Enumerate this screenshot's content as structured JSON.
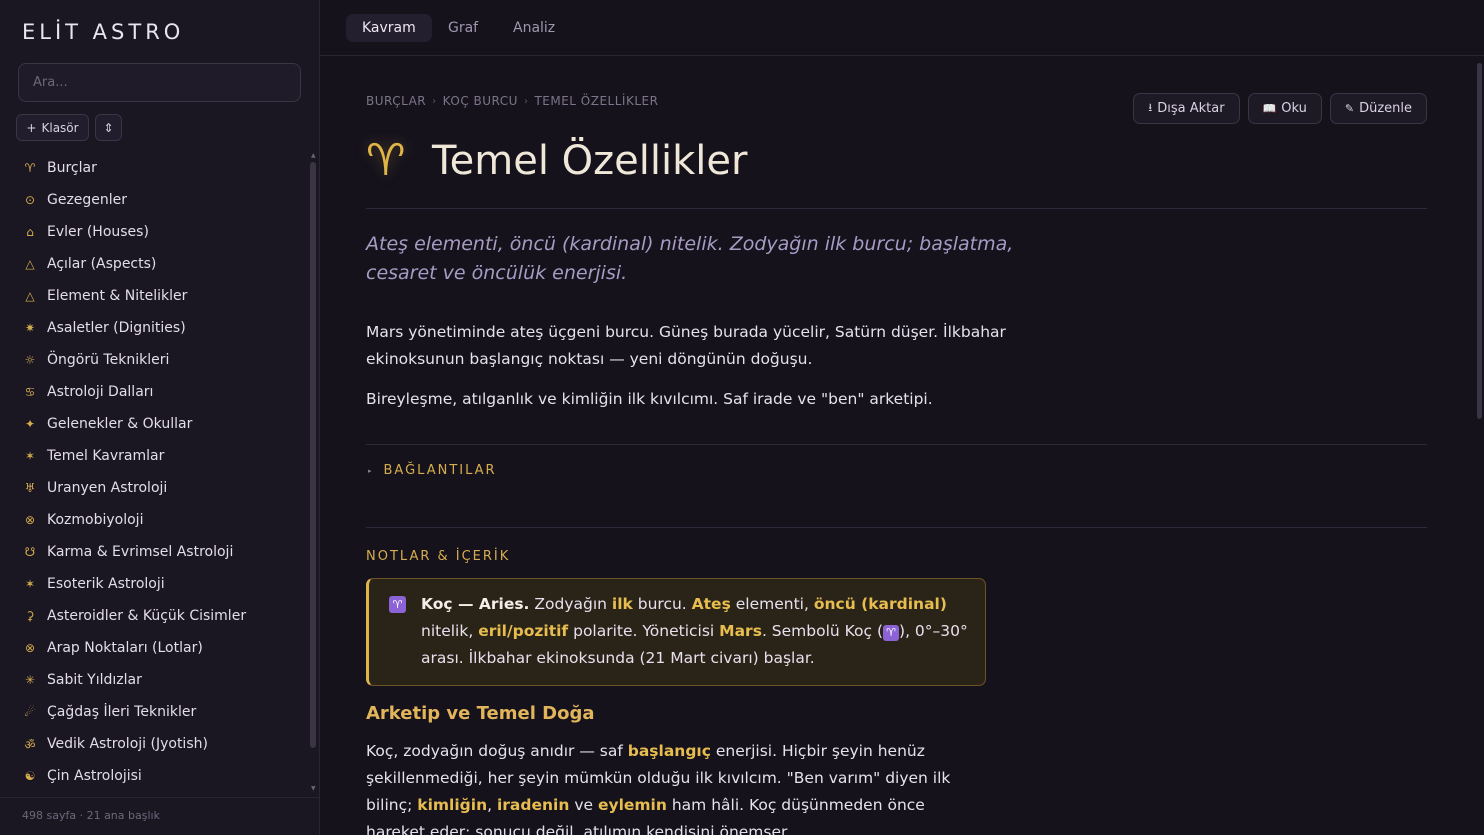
{
  "sidebar": {
    "brand": "ELİT ASTRO",
    "search_placeholder": "Ara...",
    "folder_button": {
      "icon": "+",
      "label": "Klasör"
    },
    "sort_button": "⇕",
    "items": [
      {
        "icon": "♈",
        "label": "Burçlar"
      },
      {
        "icon": "⊙",
        "label": "Gezegenler"
      },
      {
        "icon": "⌂",
        "label": "Evler (Houses)"
      },
      {
        "icon": "△",
        "label": "Açılar (Aspects)"
      },
      {
        "icon": "△",
        "label": "Element & Nitelikler"
      },
      {
        "icon": "✷",
        "label": "Asaletler (Dignities)"
      },
      {
        "icon": "☼",
        "label": "Öngörü Teknikleri"
      },
      {
        "icon": "♋",
        "label": "Astroloji Dalları"
      },
      {
        "icon": "✦",
        "label": "Gelenekler & Okullar"
      },
      {
        "icon": "✶",
        "label": "Temel Kavramlar"
      },
      {
        "icon": "♅",
        "label": "Uranyen Astroloji"
      },
      {
        "icon": "⊗",
        "label": "Kozmobiyoloji"
      },
      {
        "icon": "☋",
        "label": "Karma & Evrimsel Astroloji"
      },
      {
        "icon": "✶",
        "label": "Esoterik Astroloji"
      },
      {
        "icon": "⚳",
        "label": "Asteroidler & Küçük Cisimler"
      },
      {
        "icon": "⊗",
        "label": "Arap Noktaları (Lotlar)"
      },
      {
        "icon": "✳",
        "label": "Sabit Yıldızlar"
      },
      {
        "icon": "☄",
        "label": "Çağdaş İleri Teknikler"
      },
      {
        "icon": "ॐ",
        "label": "Vedik Astroloji (Jyotish)"
      },
      {
        "icon": "☯",
        "label": "Çin Astrolojisi"
      }
    ],
    "footer": "498 sayfa · 21 ana başlık"
  },
  "tabs": [
    {
      "label": "Kavram",
      "active": true
    },
    {
      "label": "Graf",
      "active": false
    },
    {
      "label": "Analiz",
      "active": false
    }
  ],
  "breadcrumb": [
    "BURÇLAR",
    "KOÇ BURCU",
    "TEMEL ÖZELLİKLER"
  ],
  "breadcrumb_sep": "›",
  "actions": [
    {
      "icon": "⭳",
      "label": "Dışa Aktar"
    },
    {
      "icon": "📖",
      "label": "Oku"
    },
    {
      "icon": "✎",
      "label": "Düzenle"
    }
  ],
  "page": {
    "icon": "♈",
    "title": "Temel Özellikler",
    "lead": "Ateş elementi, öncü (kardinal) nitelik. Zodyağın ilk burcu; başlatma, cesaret ve öncülük enerjisi.",
    "paragraphs": [
      "Mars yönetiminde ateş üçgeni burcu. Güneş burada yücelir, Satürn düşer. İlkbahar ekinoksunun başlangıç noktası — yeni döngünün doğuşu.",
      "Bireyleşme, atılganlık ve kimliğin ilk kıvılcımı. Saf irade ve \"ben\" arketipi."
    ],
    "links_label": "BAĞLANTILAR",
    "links_marker": "▸",
    "notes_label": "NOTLAR & İÇERİK",
    "callout": {
      "badge": "♈",
      "segments": [
        {
          "t": "Koç — Aries.",
          "s": "strong"
        },
        {
          "t": " Zodyağın ",
          "s": ""
        },
        {
          "t": "ilk",
          "s": "hl"
        },
        {
          "t": " burcu. ",
          "s": ""
        },
        {
          "t": "Ateş",
          "s": "hl"
        },
        {
          "t": " elementi, ",
          "s": ""
        },
        {
          "t": "öncü (kardinal)",
          "s": "hl"
        },
        {
          "t": " nitelik, ",
          "s": ""
        },
        {
          "t": "eril/pozitif",
          "s": "hl"
        },
        {
          "t": " polarite. Yöneticisi ",
          "s": ""
        },
        {
          "t": "Mars",
          "s": "hl"
        },
        {
          "t": ". Sembolü Koç (",
          "s": ""
        },
        {
          "t": "♈",
          "s": "badge"
        },
        {
          "t": "), 0°–30° arası. İlkbahar ekinoksunda (21 Mart civarı) başlar.",
          "s": ""
        }
      ]
    },
    "section_title": "Arketip ve Temel Doğa",
    "section_segments": [
      {
        "t": "Koç, zodyağın doğuş anıdır — saf ",
        "s": ""
      },
      {
        "t": "başlangıç",
        "s": "hl"
      },
      {
        "t": " enerjisi. Hiçbir şeyin henüz şekillenmediği, her şeyin mümkün olduğu ilk kıvılcım. \"Ben varım\" diyen ilk bilinç; ",
        "s": ""
      },
      {
        "t": "kimliğin",
        "s": "hl"
      },
      {
        "t": ", ",
        "s": ""
      },
      {
        "t": "iradenin",
        "s": "hl"
      },
      {
        "t": " ve ",
        "s": ""
      },
      {
        "t": "eylemin",
        "s": "hl"
      },
      {
        "t": " ham hâli. Koç düşünmeden önce hareket eder; sonucu değil, atılımın kendisini önemser.",
        "s": ""
      }
    ]
  }
}
